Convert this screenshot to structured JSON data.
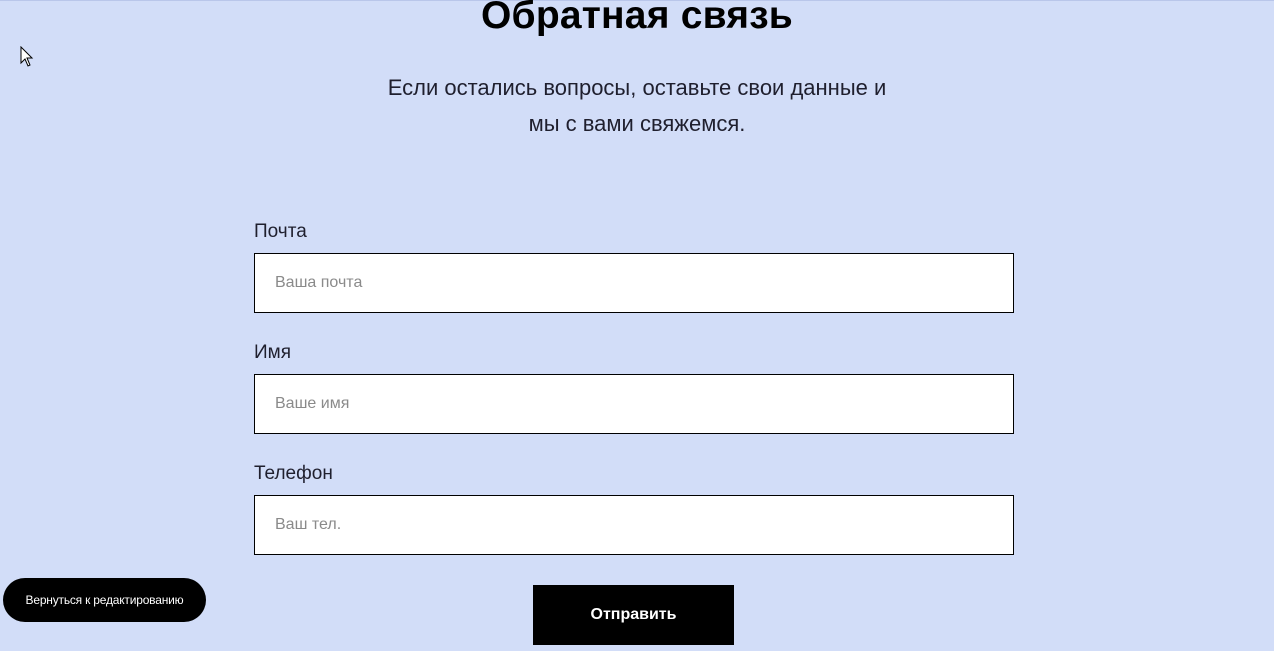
{
  "header": {
    "title": "Обратная связь",
    "subtitle_line1": "Если остались вопросы, оставьте свои данные и",
    "subtitle_line2": "мы с вами свяжемся."
  },
  "form": {
    "email": {
      "label": "Почта",
      "placeholder": "Ваша почта",
      "value": ""
    },
    "name": {
      "label": "Имя",
      "placeholder": "Ваше имя",
      "value": ""
    },
    "phone": {
      "label": "Телефон",
      "placeholder": "Ваш тел.",
      "value": ""
    },
    "submit_label": "Отправить"
  },
  "editor": {
    "back_label": "Вернуться к редактированию"
  },
  "icons": {
    "cursor": "mouse-pointer-icon"
  },
  "colors": {
    "background": "#d2ddf8",
    "button": "#000000",
    "input_bg": "#ffffff"
  }
}
